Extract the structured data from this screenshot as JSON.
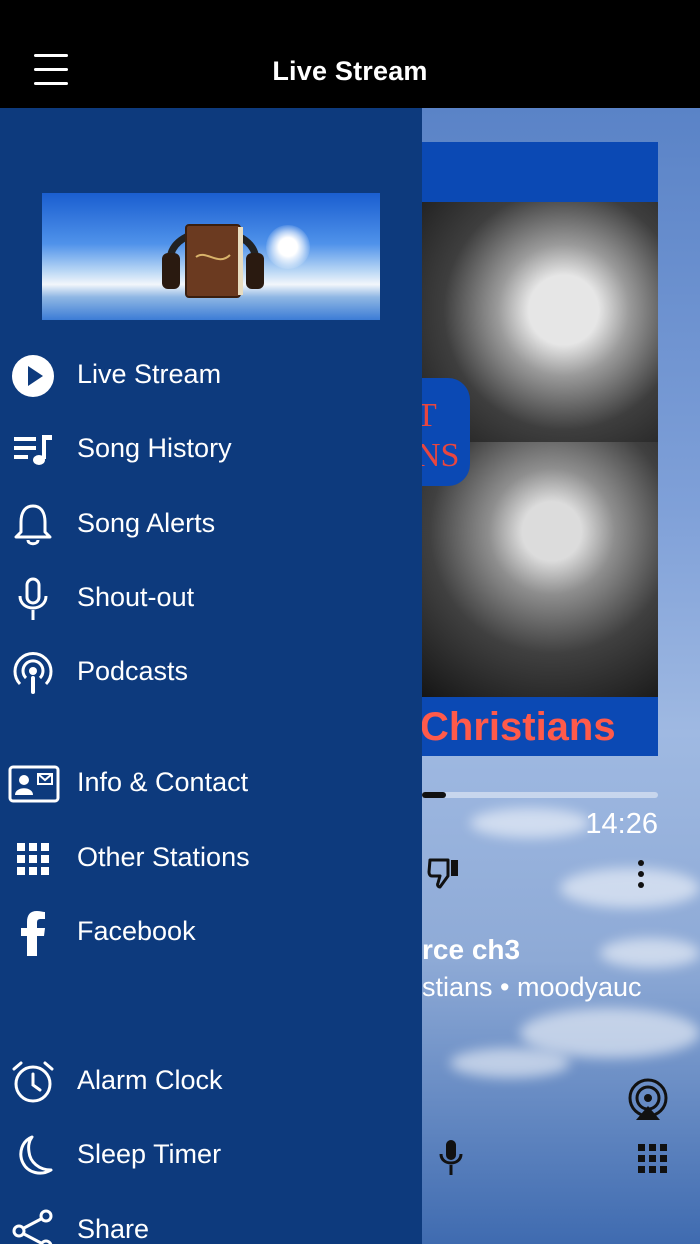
{
  "header": {
    "title": "Live Stream"
  },
  "menu": {
    "group1": [
      {
        "label": "Live Stream",
        "icon": "play-circle-icon"
      },
      {
        "label": "Song History",
        "icon": "playlist-icon"
      },
      {
        "label": "Song Alerts",
        "icon": "bell-icon"
      },
      {
        "label": "Shout-out",
        "icon": "microphone-icon"
      },
      {
        "label": "Podcasts",
        "icon": "podcast-icon"
      }
    ],
    "group2": [
      {
        "label": "Info & Contact",
        "icon": "contact-card-icon"
      },
      {
        "label": "Other Stations",
        "icon": "grid-icon"
      },
      {
        "label": "Facebook",
        "icon": "facebook-icon"
      }
    ],
    "group3": [
      {
        "label": "Alarm Clock",
        "icon": "alarm-clock-icon"
      },
      {
        "label": "Sleep Timer",
        "icon": "moon-icon"
      },
      {
        "label": "Share",
        "icon": "share-icon"
      }
    ]
  },
  "player": {
    "artwork_text": "Christians",
    "artwork_tag": "T NS",
    "time": "14:26",
    "progress": 0.1,
    "track_title": "rce ch3",
    "track_subtitle": "stians • moodyauc"
  },
  "colors": {
    "drawer": "#0d3a7d",
    "topbar": "#000000",
    "accent_red": "#ff5a4a"
  }
}
